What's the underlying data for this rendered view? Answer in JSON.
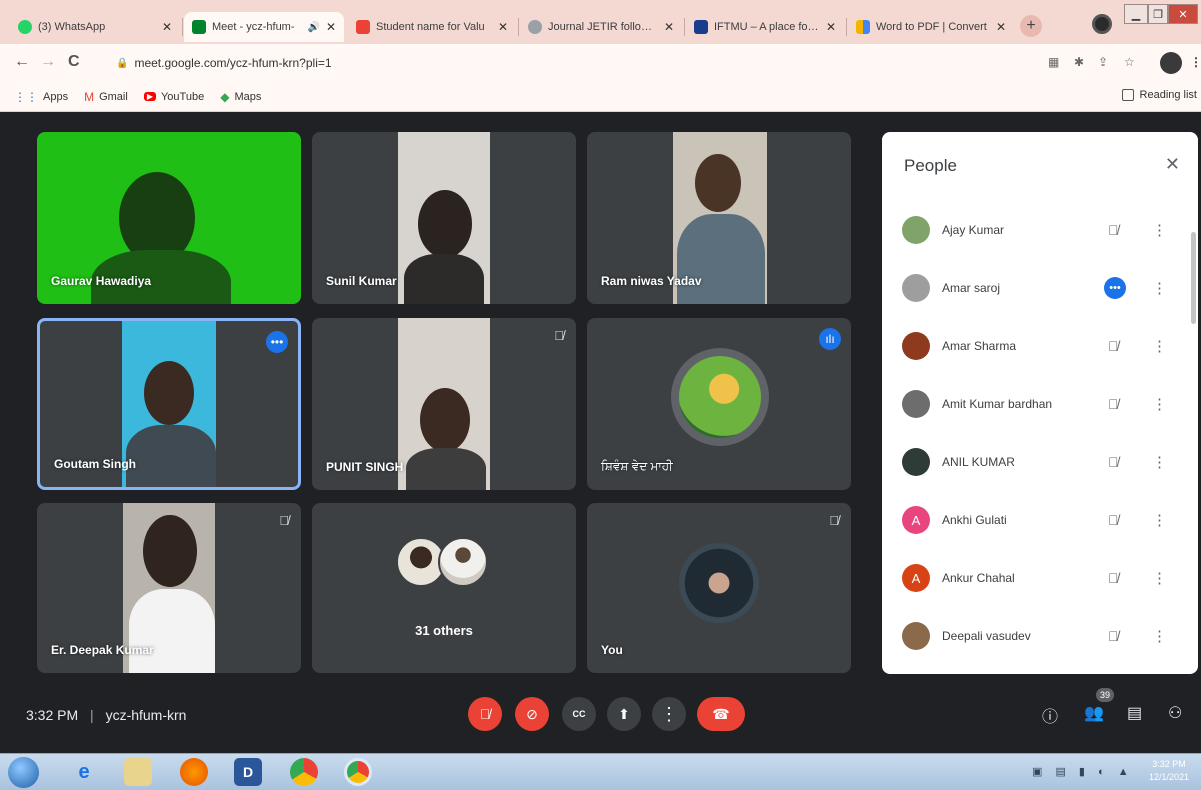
{
  "browser": {
    "tabs": [
      {
        "title": "(3) WhatsApp",
        "favicon_color": "#25d366",
        "active": false
      },
      {
        "title": "Meet - ycz-hfum-",
        "favicon_color": "#00832d",
        "active": true,
        "audio": "🔊"
      },
      {
        "title": "Student name for Valu",
        "favicon_color": "#ea4335",
        "active": false
      },
      {
        "title": "Journal JETIR follow U",
        "favicon_color": "#9aa0a6",
        "active": false
      },
      {
        "title": "IFTMU – A place for e",
        "favicon_color": "#1a3c8c",
        "active": false
      },
      {
        "title": "Word to PDF | Convert",
        "favicon_color": "#f4b400",
        "active": false
      }
    ],
    "new_tab": "+",
    "address": "meet.google.com/ycz-hfum-krn?pli=1",
    "bookmarks": [
      {
        "label": "Apps",
        "icon": "apps-grid-icon",
        "glyph": "⋮⋮"
      },
      {
        "label": "Gmail",
        "icon": "gmail-icon",
        "glyph": "M"
      },
      {
        "label": "YouTube",
        "icon": "youtube-icon",
        "glyph": "▶"
      },
      {
        "label": "Maps",
        "icon": "maps-icon",
        "glyph": "◆"
      }
    ],
    "reading_list": "Reading list"
  },
  "meeting": {
    "time": "3:32 PM",
    "code": "ycz-hfum-krn",
    "participant_count": "39"
  },
  "tiles": [
    {
      "name": "Gaurav Hawadiya"
    },
    {
      "name": "Sunil Kumar"
    },
    {
      "name": "Ram niwas Yadav"
    },
    {
      "name": "Goutam Singh"
    },
    {
      "name": "PUNIT SINGH"
    },
    {
      "name": "ਸ਼ਿਵੰਸ਼ ਵੇਦ ਮਾਹੀ"
    },
    {
      "name": "Er. Deepak Kumar"
    },
    {
      "name": "31 others"
    },
    {
      "name": "You"
    }
  ],
  "people_panel": {
    "title": "People",
    "people": [
      {
        "name": "Ajay Kumar",
        "initial": "",
        "avatar_color": "#7fa36a",
        "state": "muted"
      },
      {
        "name": "Amar saroj",
        "initial": "",
        "avatar_color": "#9e9e9e",
        "state": "speaking"
      },
      {
        "name": "Amar Sharma",
        "initial": "",
        "avatar_color": "#8d3a1e",
        "state": "muted"
      },
      {
        "name": "Amit Kumar bardhan",
        "initial": "",
        "avatar_color": "#6d6d6d",
        "state": "muted"
      },
      {
        "name": "ANIL KUMAR",
        "initial": "",
        "avatar_color": "#2f3b36",
        "state": "muted"
      },
      {
        "name": "Ankhi Gulati",
        "initial": "A",
        "avatar_color": "#e8457f",
        "state": "muted"
      },
      {
        "name": "Ankur Chahal",
        "initial": "A",
        "avatar_color": "#d84315",
        "state": "muted"
      },
      {
        "name": "Deepali vasudev",
        "initial": "",
        "avatar_color": "#8a6a4a",
        "state": "muted"
      }
    ]
  },
  "taskbar": {
    "clock_time": "3:32 PM",
    "clock_date": "12/1/2021"
  }
}
